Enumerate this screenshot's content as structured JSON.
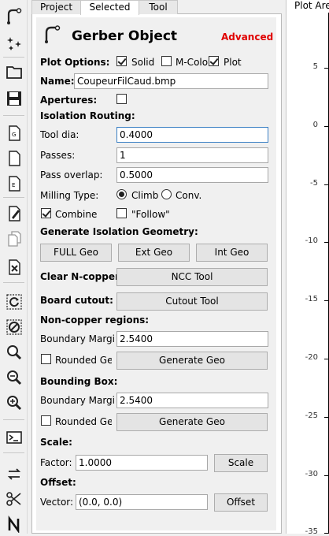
{
  "toolbar": {
    "icons": [
      "geometry-cursor-icon",
      "snap-icon",
      "open-folder-icon",
      "save-icon",
      "new-gerber-icon",
      "new-file-icon",
      "new-excellon-icon",
      "edit-icon",
      "copy-icon",
      "delete-icon",
      "replot-icon",
      "clear-plot-icon",
      "zoom-fit-icon",
      "zoom-in-icon",
      "zoom-out-icon",
      "shell-icon",
      "move-icon",
      "cut-icon",
      "n-icon"
    ]
  },
  "tabs": [
    {
      "label": "Project"
    },
    {
      "label": "Selected"
    },
    {
      "label": "Tool"
    }
  ],
  "header": {
    "title": "Gerber Object",
    "advanced": "Advanced",
    "advanced_color": "#e00000"
  },
  "plot_options": {
    "label": "Plot Options:",
    "solid": "Solid",
    "mcolo": "M-Colo",
    "plot": "Plot"
  },
  "name": {
    "label": "Name:",
    "value": "CoupeurFilCaud.bmp"
  },
  "apertures": {
    "label": "Apertures:"
  },
  "isolation": {
    "title": "Isolation Routing:",
    "tool_dia_label": "Tool dia:",
    "tool_dia": "0.4000",
    "passes_label": "Passes:",
    "passes": "1",
    "overlap_label": "Pass overlap:",
    "overlap": "0.5000",
    "milling_label": "Milling Type:",
    "climb": "Climb",
    "conv": "Conv.",
    "combine": "Combine",
    "follow": "\"Follow\""
  },
  "geometry": {
    "title": "Generate Isolation Geometry:",
    "full": "FULL Geo",
    "ext": "Ext Geo",
    "int": "Int Geo"
  },
  "ncc": {
    "label": "Clear N-copper",
    "button": "NCC Tool"
  },
  "cutout": {
    "label": "Board cutout:",
    "button": "Cutout Tool"
  },
  "noncopper": {
    "title": "Non-copper regions:",
    "margin_label": "Boundary Margin",
    "margin": "2.5400",
    "rounded": "Rounded Geo",
    "button": "Generate Geo"
  },
  "bbox": {
    "title": "Bounding Box:",
    "margin_label": "Boundary Margin",
    "margin": "2.5400",
    "rounded": "Rounded Geo",
    "button": "Generate Geo"
  },
  "scale": {
    "title": "Scale:",
    "factor_label": "Factor:",
    "factor": "1.0000",
    "button": "Scale"
  },
  "offset": {
    "title": "Offset:",
    "vector_label": "Vector:",
    "vector": "(0.0, 0.0)",
    "button": "Offset"
  },
  "plot": {
    "title": "Plot Area",
    "yticks": [
      "5",
      "0",
      "-5",
      "-10",
      "-15",
      "-20",
      "-25",
      "-30",
      "-35"
    ]
  }
}
